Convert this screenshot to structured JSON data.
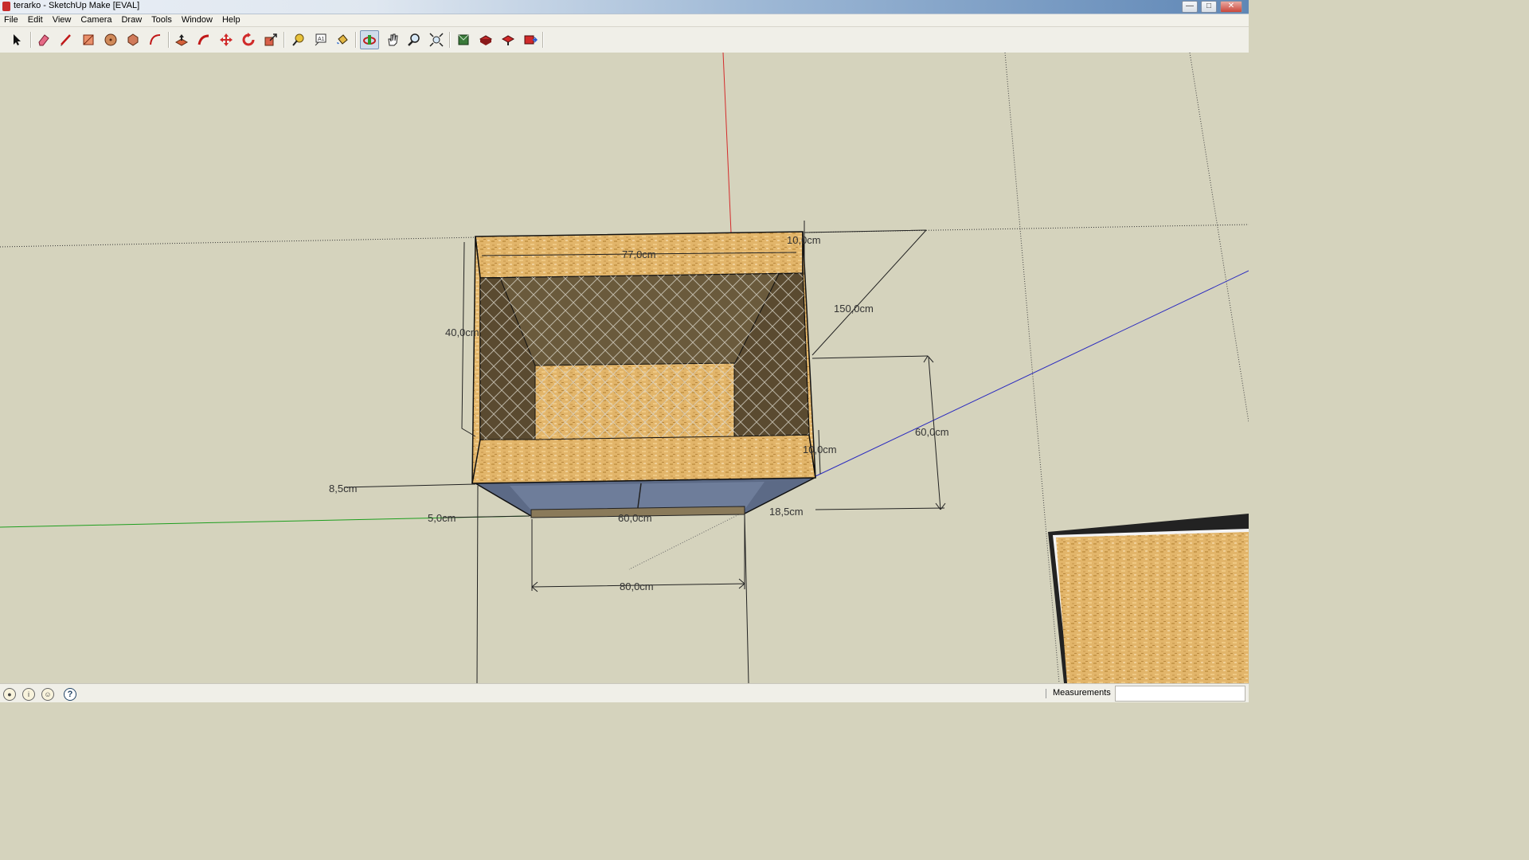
{
  "window": {
    "title": "terarko - SketchUp Make [EVAL]",
    "minimize_glyph": "—",
    "restore_glyph": "□",
    "close_glyph": "✕"
  },
  "menu": {
    "items": [
      "File",
      "Edit",
      "View",
      "Camera",
      "Draw",
      "Tools",
      "Window",
      "Help"
    ]
  },
  "toolbar": {
    "tools": [
      {
        "icon": "select-arrow-icon",
        "active": false
      },
      {
        "icon": "eraser-icon",
        "active": false
      },
      {
        "icon": "pencil-line-icon",
        "active": false
      },
      {
        "icon": "rectangle-icon",
        "active": false
      },
      {
        "icon": "circle-icon",
        "active": false
      },
      {
        "icon": "polygon-icon",
        "active": false
      },
      {
        "icon": "arc-icon",
        "active": false
      },
      {
        "icon": "push-pull-icon",
        "active": false
      },
      {
        "icon": "follow-me-icon",
        "active": false
      },
      {
        "icon": "move-icon",
        "active": false
      },
      {
        "icon": "rotate-icon",
        "active": false
      },
      {
        "icon": "scale-icon",
        "active": false
      },
      {
        "icon": "tape-measure-icon",
        "active": false
      },
      {
        "icon": "text-label-icon",
        "active": false
      },
      {
        "icon": "paint-bucket-icon",
        "active": false
      },
      {
        "icon": "orbit-icon",
        "active": true
      },
      {
        "icon": "pan-hand-icon",
        "active": false
      },
      {
        "icon": "zoom-icon",
        "active": false
      },
      {
        "icon": "zoom-extents-icon",
        "active": false
      },
      {
        "icon": "3d-warehouse-icon",
        "active": false
      },
      {
        "icon": "get-models-icon",
        "active": false
      },
      {
        "icon": "share-component-icon",
        "active": false
      },
      {
        "icon": "extension-warehouse-icon",
        "active": false
      }
    ]
  },
  "model": {
    "dimensions": [
      "77,0cm",
      "10,0cm",
      "150,0cm",
      "40,0cm",
      "60,0cm",
      "10,0cm",
      "8,5cm",
      "5,0cm",
      "60,0cm",
      "18,5cm",
      "80,0cm"
    ],
    "axis_colors": {
      "red": "#d42b2b",
      "green": "#1e9e1e",
      "blue": "#2b2bbf"
    },
    "material_colors": {
      "osb": "#e2b56a",
      "mesh_dark": "#6a5a3c",
      "glass": "#5c6a86"
    }
  },
  "status": {
    "icons": [
      "geo-location-icon",
      "credits-icon",
      "sign-in-icon",
      "help-icon"
    ],
    "help_glyph": "?",
    "measurements_label": "Measurements",
    "measurements_value": ""
  }
}
